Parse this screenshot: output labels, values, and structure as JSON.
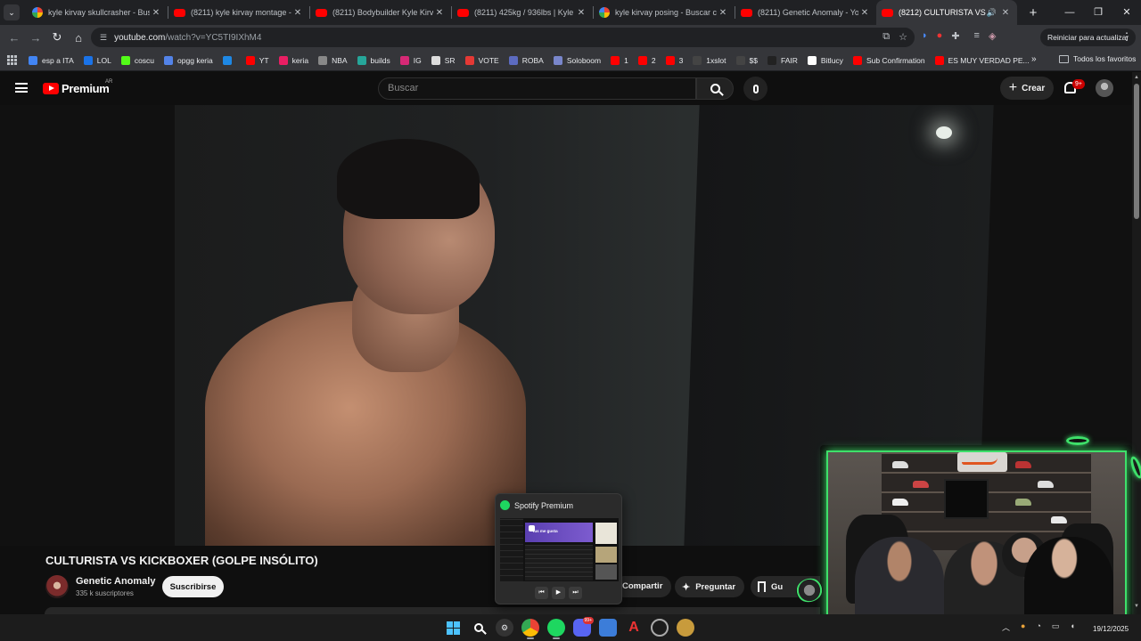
{
  "browser": {
    "tabs": [
      {
        "title": "kyle kirvay skullcrasher - Buscar",
        "favicon": "google-icon",
        "active": false
      },
      {
        "title": "(8211) kyle kirvay montage - Yo",
        "favicon": "youtube-icon",
        "active": false
      },
      {
        "title": "(8211) Bodybuilder Kyle Kirvay",
        "favicon": "youtube-icon",
        "active": false
      },
      {
        "title": "(8211) 425kg / 936lbs | Kyle Ki",
        "favicon": "youtube-icon",
        "active": false
      },
      {
        "title": "kyle kirvay posing - Buscar con",
        "favicon": "google-icon",
        "active": false
      },
      {
        "title": "(8211) Genetic Anomaly - YouT",
        "favicon": "youtube-icon",
        "active": false
      },
      {
        "title": "(8212) CULTURISTA VS KICK",
        "favicon": "youtube-icon",
        "active": true
      }
    ],
    "new_tab_label": "+",
    "url_host": "youtube.com",
    "url_path": "/watch?v=YC5TI9IXhM4",
    "restart_label": "Reiniciar para actualizar",
    "bookmarks": [
      {
        "label": "esp a ITA",
        "color": "#4285f4"
      },
      {
        "label": "LOL",
        "color": "#1a73e8"
      },
      {
        "label": "coscu",
        "color": "#53fc18"
      },
      {
        "label": "opgg keria",
        "color": "#5383e8"
      },
      {
        "label": "",
        "color": "#1e88e5"
      },
      {
        "label": "YT",
        "color": "#ff0000"
      },
      {
        "label": "keria",
        "color": "#e91e63"
      },
      {
        "label": "NBA",
        "color": "#888888"
      },
      {
        "label": "builds",
        "color": "#26a69a"
      },
      {
        "label": "IG",
        "color": "#d62976"
      },
      {
        "label": "SR",
        "color": "#dddddd"
      },
      {
        "label": "VOTE",
        "color": "#e53935"
      },
      {
        "label": "ROBA",
        "color": "#5c6bc0"
      },
      {
        "label": "Soloboom",
        "color": "#7986cb"
      },
      {
        "label": "1",
        "color": "#ff0000"
      },
      {
        "label": "2",
        "color": "#ff0000"
      },
      {
        "label": "3",
        "color": "#ff0000"
      },
      {
        "label": "1xslot",
        "color": "#444444"
      },
      {
        "label": "$$",
        "color": "#444444"
      },
      {
        "label": "FAIR",
        "color": "#222222"
      },
      {
        "label": "Bitlucy",
        "color": "#ffffff"
      },
      {
        "label": "Sub Confirmation",
        "color": "#ff0000"
      },
      {
        "label": "ES MUY VERDAD PE...",
        "color": "#ff0000"
      }
    ],
    "more_bookmarks": "»",
    "all_favorites": "Todos los favoritos"
  },
  "youtube": {
    "logo_word": "Premium",
    "country_code": "AR",
    "search_placeholder": "Buscar",
    "create_label": "Crear",
    "notifications_badge": "9+",
    "video_title": "CULTURISTA VS KICKBOXER (GOLPE INSÓLITO)",
    "channel_name": "Genetic Anomaly",
    "channel_subs": "335 k suscriptores",
    "subscribe_label": "Suscribirse",
    "share_label": "Compartir",
    "ask_label": "Preguntar",
    "save_label": "Gu"
  },
  "spotify_preview": {
    "title": "Spotify Premium",
    "hero_text": "Tus me gusta"
  },
  "taskbar": {
    "date": "19/12/2025",
    "discord_badge": "99+"
  }
}
